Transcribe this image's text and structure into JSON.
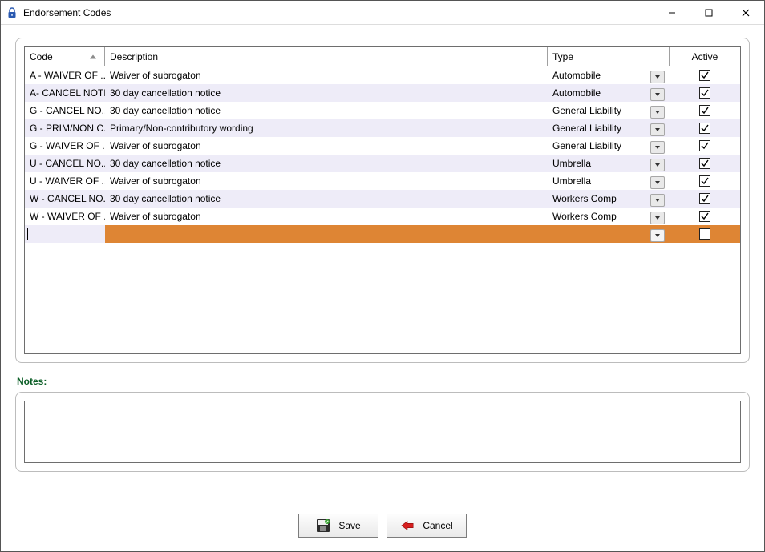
{
  "window": {
    "title": "Endorsement Codes"
  },
  "columns": {
    "code": "Code",
    "description": "Description",
    "type": "Type",
    "active": "Active"
  },
  "rows": [
    {
      "code": "A - WAIVER OF ...",
      "description": "Waiver of subrogaton",
      "type": "Automobile",
      "active": true
    },
    {
      "code": "A- CANCEL NOTI...",
      "description": "30 day cancellation notice",
      "type": "Automobile",
      "active": true
    },
    {
      "code": "G - CANCEL NO...",
      "description": "30 day cancellation notice",
      "type": "General Liability",
      "active": true
    },
    {
      "code": "G - PRIM/NON C...",
      "description": "Primary/Non-contributory wording",
      "type": "General Liability",
      "active": true
    },
    {
      "code": "G - WAIVER OF ...",
      "description": "Waiver of subrogaton",
      "type": "General Liability",
      "active": true
    },
    {
      "code": "U - CANCEL NO...",
      "description": "30 day cancellation notice",
      "type": "Umbrella",
      "active": true
    },
    {
      "code": "U - WAIVER OF ...",
      "description": "Waiver of subrogaton",
      "type": "Umbrella",
      "active": true
    },
    {
      "code": "W - CANCEL NO...",
      "description": "30 day cancellation notice",
      "type": "Workers Comp",
      "active": true
    },
    {
      "code": "W - WAIVER OF ...",
      "description": "Waiver of subrogaton",
      "type": "Workers Comp",
      "active": true
    }
  ],
  "newrow": {
    "active": false
  },
  "notes": {
    "label": "Notes:"
  },
  "buttons": {
    "save": "Save",
    "cancel": "Cancel"
  }
}
